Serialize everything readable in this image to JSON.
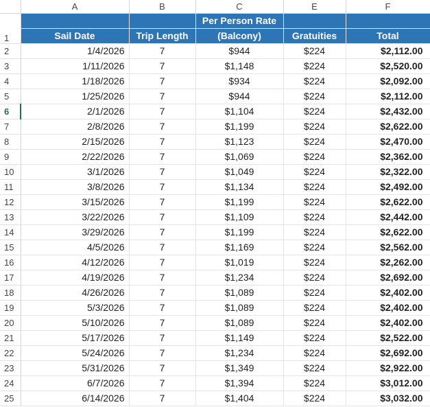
{
  "columns": [
    "A",
    "B",
    "C",
    "E",
    "F"
  ],
  "header": {
    "row_top": {
      "rate": "Per Person Rate"
    },
    "row_bottom": {
      "sail_date": "Sail Date",
      "trip_length": "Trip Length",
      "rate": "(Balcony)",
      "gratuities": "Gratuities",
      "total": "Total"
    }
  },
  "header_row_number": "1",
  "selected_row": "6",
  "colors": {
    "header_fill": "#2e75b6",
    "header_text": "#ffffff",
    "selected_row_number": "#217346"
  },
  "rows": [
    {
      "num": "2",
      "date": "1/4/2026",
      "len": "7",
      "rate": "$944",
      "grat": "$224",
      "total": "$2,112.00"
    },
    {
      "num": "3",
      "date": "1/11/2026",
      "len": "7",
      "rate": "$1,148",
      "grat": "$224",
      "total": "$2,520.00"
    },
    {
      "num": "4",
      "date": "1/18/2026",
      "len": "7",
      "rate": "$934",
      "grat": "$224",
      "total": "$2,092.00"
    },
    {
      "num": "5",
      "date": "1/25/2026",
      "len": "7",
      "rate": "$944",
      "grat": "$224",
      "total": "$2,112.00"
    },
    {
      "num": "6",
      "date": "2/1/2026",
      "len": "7",
      "rate": "$1,104",
      "grat": "$224",
      "total": "$2,432.00"
    },
    {
      "num": "7",
      "date": "2/8/2026",
      "len": "7",
      "rate": "$1,199",
      "grat": "$224",
      "total": "$2,622.00"
    },
    {
      "num": "8",
      "date": "2/15/2026",
      "len": "7",
      "rate": "$1,123",
      "grat": "$224",
      "total": "$2,470.00"
    },
    {
      "num": "9",
      "date": "2/22/2026",
      "len": "7",
      "rate": "$1,069",
      "grat": "$224",
      "total": "$2,362.00"
    },
    {
      "num": "10",
      "date": "3/1/2026",
      "len": "7",
      "rate": "$1,049",
      "grat": "$224",
      "total": "$2,322.00"
    },
    {
      "num": "11",
      "date": "3/8/2026",
      "len": "7",
      "rate": "$1,134",
      "grat": "$224",
      "total": "$2,492.00"
    },
    {
      "num": "12",
      "date": "3/15/2026",
      "len": "7",
      "rate": "$1,199",
      "grat": "$224",
      "total": "$2,622.00"
    },
    {
      "num": "13",
      "date": "3/22/2026",
      "len": "7",
      "rate": "$1,109",
      "grat": "$224",
      "total": "$2,442.00"
    },
    {
      "num": "14",
      "date": "3/29/2026",
      "len": "7",
      "rate": "$1,199",
      "grat": "$224",
      "total": "$2,622.00"
    },
    {
      "num": "15",
      "date": "4/5/2026",
      "len": "7",
      "rate": "$1,169",
      "grat": "$224",
      "total": "$2,562.00"
    },
    {
      "num": "16",
      "date": "4/12/2026",
      "len": "7",
      "rate": "$1,019",
      "grat": "$224",
      "total": "$2,262.00"
    },
    {
      "num": "17",
      "date": "4/19/2026",
      "len": "7",
      "rate": "$1,234",
      "grat": "$224",
      "total": "$2,692.00"
    },
    {
      "num": "18",
      "date": "4/26/2026",
      "len": "7",
      "rate": "$1,089",
      "grat": "$224",
      "total": "$2,402.00"
    },
    {
      "num": "19",
      "date": "5/3/2026",
      "len": "7",
      "rate": "$1,089",
      "grat": "$224",
      "total": "$2,402.00"
    },
    {
      "num": "20",
      "date": "5/10/2026",
      "len": "7",
      "rate": "$1,089",
      "grat": "$224",
      "total": "$2,402.00"
    },
    {
      "num": "21",
      "date": "5/17/2026",
      "len": "7",
      "rate": "$1,149",
      "grat": "$224",
      "total": "$2,522.00"
    },
    {
      "num": "22",
      "date": "5/24/2026",
      "len": "7",
      "rate": "$1,234",
      "grat": "$224",
      "total": "$2,692.00"
    },
    {
      "num": "23",
      "date": "5/31/2026",
      "len": "7",
      "rate": "$1,349",
      "grat": "$224",
      "total": "$2,922.00"
    },
    {
      "num": "24",
      "date": "6/7/2026",
      "len": "7",
      "rate": "$1,394",
      "grat": "$224",
      "total": "$3,012.00"
    },
    {
      "num": "25",
      "date": "6/14/2026",
      "len": "7",
      "rate": "$1,404",
      "grat": "$224",
      "total": "$3,032.00"
    }
  ]
}
